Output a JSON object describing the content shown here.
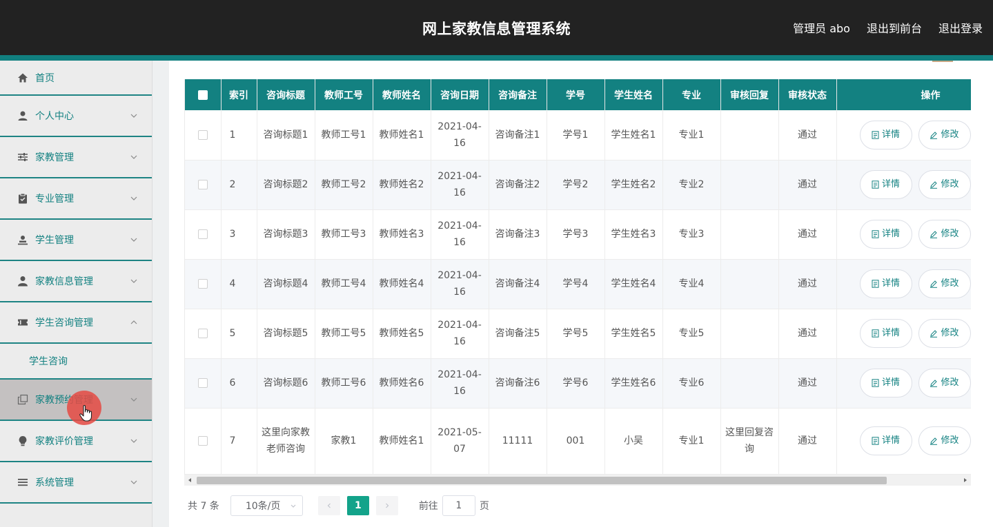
{
  "header": {
    "title": "网上家教信息管理系统",
    "user_label": "管理员 abo",
    "front_link": "退出到前台",
    "logout_link": "退出登录"
  },
  "sidebar": {
    "items": [
      {
        "label": "首页",
        "icon": "home-icon"
      },
      {
        "label": "个人中心",
        "icon": "user-icon"
      },
      {
        "label": "家教管理",
        "icon": "sliders-icon"
      },
      {
        "label": "专业管理",
        "icon": "clipboard-icon"
      },
      {
        "label": "学生管理",
        "icon": "student-icon"
      },
      {
        "label": "家教信息管理",
        "icon": "person-icon"
      },
      {
        "label": "学生咨询管理",
        "icon": "ticket-icon"
      },
      {
        "label": "家教预约管理",
        "icon": "copy-icon"
      },
      {
        "label": "家教评价管理",
        "icon": "bulb-icon"
      },
      {
        "label": "系统管理",
        "icon": "list-icon"
      }
    ],
    "submenu": {
      "label": "学生咨询"
    }
  },
  "table": {
    "columns": [
      "索引",
      "咨询标题",
      "教师工号",
      "教师姓名",
      "咨询日期",
      "咨询备注",
      "学号",
      "学生姓名",
      "专业",
      "审核回复",
      "审核状态",
      "操作"
    ],
    "rows": [
      [
        "1",
        "咨询标题1",
        "教师工号1",
        "教师姓名1",
        "2021-04-16",
        "咨询备注1",
        "学号1",
        "学生姓名1",
        "专业1",
        "",
        "通过"
      ],
      [
        "2",
        "咨询标题2",
        "教师工号2",
        "教师姓名2",
        "2021-04-16",
        "咨询备注2",
        "学号2",
        "学生姓名2",
        "专业2",
        "",
        "通过"
      ],
      [
        "3",
        "咨询标题3",
        "教师工号3",
        "教师姓名3",
        "2021-04-16",
        "咨询备注3",
        "学号3",
        "学生姓名3",
        "专业3",
        "",
        "通过"
      ],
      [
        "4",
        "咨询标题4",
        "教师工号4",
        "教师姓名4",
        "2021-04-16",
        "咨询备注4",
        "学号4",
        "学生姓名4",
        "专业4",
        "",
        "通过"
      ],
      [
        "5",
        "咨询标题5",
        "教师工号5",
        "教师姓名5",
        "2021-04-16",
        "咨询备注5",
        "学号5",
        "学生姓名5",
        "专业5",
        "",
        "通过"
      ],
      [
        "6",
        "咨询标题6",
        "教师工号6",
        "教师姓名6",
        "2021-04-16",
        "咨询备注6",
        "学号6",
        "学生姓名6",
        "专业6",
        "",
        "通过"
      ],
      [
        "7",
        "这里向家教老师咨询",
        "家教1",
        "教师姓名1",
        "2021-05-07",
        "11111",
        "001",
        "小吴",
        "专业1",
        "这里回复咨询",
        "通过"
      ]
    ],
    "actions": {
      "detail": "详情",
      "edit": "修改"
    }
  },
  "pagination": {
    "total": "共 7 条",
    "page_size": "10条/页",
    "current_page": "1",
    "goto_prefix": "前往",
    "goto_value": "1",
    "goto_suffix": "页"
  },
  "colors": {
    "accent": "#138181",
    "header_bg": "#222222",
    "active_page": "#13a38a",
    "cursor": "#e54a43"
  }
}
